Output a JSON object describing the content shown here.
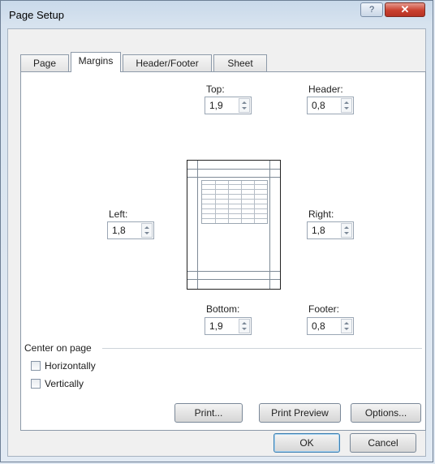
{
  "window": {
    "title": "Page Setup"
  },
  "titlebar": {
    "help_glyph": "?",
    "close_glyph": "✕"
  },
  "tabs": [
    {
      "label": "Page",
      "active": false
    },
    {
      "label": "Margins",
      "active": true
    },
    {
      "label": "Header/Footer",
      "active": false
    },
    {
      "label": "Sheet",
      "active": false
    }
  ],
  "margins": {
    "top": {
      "label": "Top:",
      "value": "1,9"
    },
    "header": {
      "label": "Header:",
      "value": "0,8"
    },
    "left": {
      "label": "Left:",
      "value": "1,8"
    },
    "right": {
      "label": "Right:",
      "value": "1,8"
    },
    "bottom": {
      "label": "Bottom:",
      "value": "1,9"
    },
    "footer": {
      "label": "Footer:",
      "value": "0,8"
    }
  },
  "center_on_page": {
    "label": "Center on page",
    "horizontally": {
      "label": "Horizontally",
      "checked": false
    },
    "vertically": {
      "label": "Vertically",
      "checked": false
    }
  },
  "actions": {
    "print": "Print...",
    "print_preview": "Print Preview",
    "options": "Options..."
  },
  "footer_buttons": {
    "ok": "OK",
    "cancel": "Cancel"
  }
}
